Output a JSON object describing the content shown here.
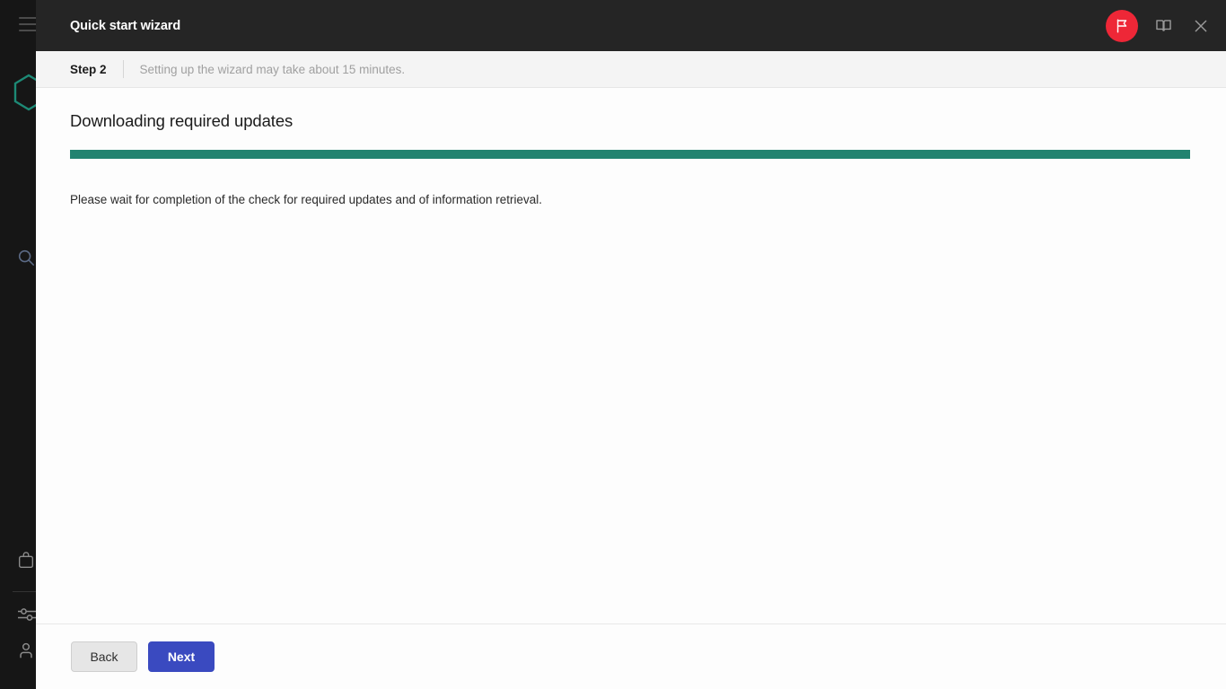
{
  "sidebar": {
    "menu_icon": "hamburger-menu-icon",
    "logo": "hexagon-logo-icon",
    "items": [
      {
        "icon": "search-icon",
        "name": "search"
      },
      {
        "icon": "bag-icon",
        "name": "bag"
      },
      {
        "icon": "sliders-icon",
        "name": "settings-sliders"
      },
      {
        "icon": "user-icon",
        "name": "user-account"
      }
    ]
  },
  "titlebar": {
    "title": "Quick start wizard",
    "flag_icon": "flag-icon",
    "help_icon": "book-icon",
    "close_icon": "close-icon",
    "flag_badge_color": "#ee2737"
  },
  "step_bar": {
    "step_label": "Step 2",
    "note": "Setting up the wizard may take about 15 minutes."
  },
  "main": {
    "heading": "Downloading required updates",
    "progress": {
      "percent": 100,
      "fill_color": "#228370",
      "track_color": "#e9e9e9"
    },
    "note": "Please wait for completion of the check for required updates and of information retrieval."
  },
  "footer": {
    "back_label": "Back",
    "next_label": "Next",
    "primary_color": "#3a4ac0"
  }
}
